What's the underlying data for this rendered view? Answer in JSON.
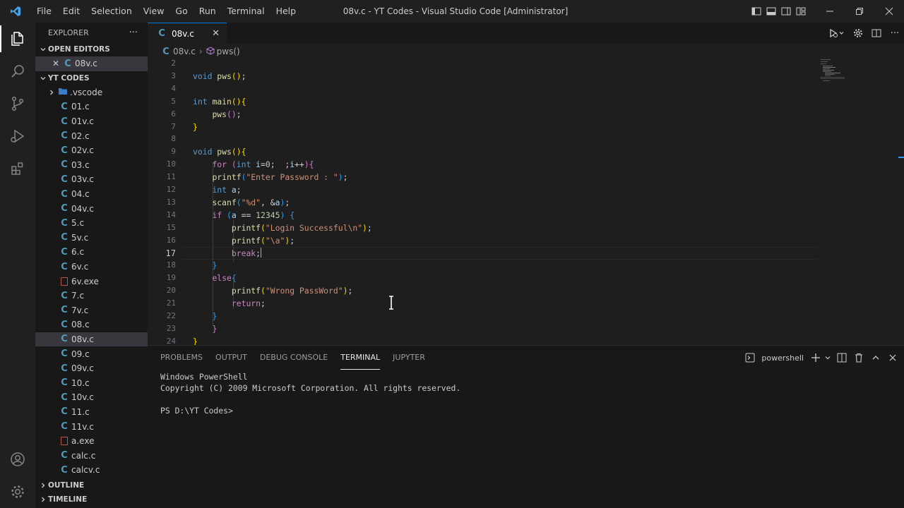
{
  "window": {
    "title": "08v.c - YT Codes - Visual Studio Code [Administrator]"
  },
  "menu": [
    "File",
    "Edit",
    "Selection",
    "View",
    "Go",
    "Run",
    "Terminal",
    "Help"
  ],
  "sidebar": {
    "title": "EXPLORER",
    "more": "···",
    "open_editors_label": "OPEN EDITORS",
    "open_editor_file": "08v.c",
    "folder_label": "YT CODES",
    "files": [
      {
        "name": ".vscode",
        "type": "folder"
      },
      {
        "name": "01.c",
        "type": "c"
      },
      {
        "name": "01v.c",
        "type": "c"
      },
      {
        "name": "02.c",
        "type": "c"
      },
      {
        "name": "02v.c",
        "type": "c"
      },
      {
        "name": "03.c",
        "type": "c"
      },
      {
        "name": "03v.c",
        "type": "c"
      },
      {
        "name": "04.c",
        "type": "c"
      },
      {
        "name": "04v.c",
        "type": "c"
      },
      {
        "name": "5.c",
        "type": "c"
      },
      {
        "name": "5v.c",
        "type": "c"
      },
      {
        "name": "6.c",
        "type": "c"
      },
      {
        "name": "6v.c",
        "type": "c"
      },
      {
        "name": "6v.exe",
        "type": "exe"
      },
      {
        "name": "7.c",
        "type": "c"
      },
      {
        "name": "7v.c",
        "type": "c"
      },
      {
        "name": "08.c",
        "type": "c"
      },
      {
        "name": "08v.c",
        "type": "c",
        "selected": true
      },
      {
        "name": "09.c",
        "type": "c"
      },
      {
        "name": "09v.c",
        "type": "c"
      },
      {
        "name": "10.c",
        "type": "c"
      },
      {
        "name": "10v.c",
        "type": "c"
      },
      {
        "name": "11.c",
        "type": "c"
      },
      {
        "name": "11v.c",
        "type": "c"
      },
      {
        "name": "a.exe",
        "type": "exe"
      },
      {
        "name": "calc.c",
        "type": "c"
      },
      {
        "name": "calcv.c",
        "type": "c"
      }
    ],
    "outline_label": "OUTLINE",
    "timeline_label": "TIMELINE"
  },
  "editor": {
    "tab_label": "08v.c",
    "breadcrumb_file": "08v.c",
    "breadcrumb_symbol": "pws()",
    "current_line": 17,
    "lines": [
      {
        "n": "2",
        "html": ""
      },
      {
        "n": "3",
        "html": "<span class=\"kw\">void</span> <span class=\"fn\">pws</span><span class=\"p1\">()</span>;"
      },
      {
        "n": "4",
        "html": ""
      },
      {
        "n": "5",
        "html": "<span class=\"kw\">int</span> <span class=\"fn\">main</span><span class=\"p1\">(){</span>"
      },
      {
        "n": "6",
        "html": "    <span class=\"fn\">pws</span><span class=\"p2\">()</span>;"
      },
      {
        "n": "7",
        "html": "<span class=\"p1\">}</span>"
      },
      {
        "n": "8",
        "html": ""
      },
      {
        "n": "9",
        "html": "<span class=\"kw\">void</span> <span class=\"fn\">pws</span><span class=\"p1\">(){</span>"
      },
      {
        "n": "10",
        "html": "    <span class=\"ctl\">for</span> <span class=\"p2\">(</span><span class=\"kw\">int</span> <span class=\"var\">i</span>=<span class=\"num\">0</span>;  ;<span class=\"var\">i</span>++<span class=\"p2\">){</span>"
      },
      {
        "n": "11",
        "html": "    <span class=\"fn\">printf</span><span class=\"p3\">(</span><span class=\"str\">\"Enter Password : \"</span><span class=\"p3\">)</span>;"
      },
      {
        "n": "12",
        "html": "    <span class=\"kw\">int</span> <span class=\"var\">a</span>;"
      },
      {
        "n": "13",
        "html": "    <span class=\"fn\">scanf</span><span class=\"p3\">(</span><span class=\"str\">\"%d\"</span>, &amp;<span class=\"var\">a</span><span class=\"p3\">)</span>;"
      },
      {
        "n": "14",
        "html": "    <span class=\"ctl\">if</span> <span class=\"p3\">(</span><span class=\"var\">a</span> == <span class=\"num\">12345</span><span class=\"p3\">)</span> <span class=\"p3\">{</span>"
      },
      {
        "n": "15",
        "html": "        <span class=\"fn\">printf</span><span class=\"p1\">(</span><span class=\"str\">\"Login Successful\\n\"</span><span class=\"p1\">)</span>;"
      },
      {
        "n": "16",
        "html": "        <span class=\"fn\">printf</span><span class=\"p1\">(</span><span class=\"str\">\"\\a\"</span><span class=\"p1\">)</span>;"
      },
      {
        "n": "17",
        "html": "        <span class=\"ctl\">break</span>;"
      },
      {
        "n": "18",
        "html": "    <span class=\"p3\">}</span>"
      },
      {
        "n": "19",
        "html": "    <span class=\"ctl\">else</span><span class=\"p3\">{</span>"
      },
      {
        "n": "20",
        "html": "        <span class=\"fn\">printf</span><span class=\"p1\">(</span><span class=\"str\">\"Wrong PassWord\"</span><span class=\"p1\">)</span>;"
      },
      {
        "n": "21",
        "html": "        <span class=\"ctl\">return</span>;"
      },
      {
        "n": "22",
        "html": "    <span class=\"p3\">}</span>"
      },
      {
        "n": "23",
        "html": "    <span class=\"p2\">}</span>"
      },
      {
        "n": "24",
        "html": "<span class=\"p1\">}</span>"
      }
    ]
  },
  "panel": {
    "tabs": [
      "PROBLEMS",
      "OUTPUT",
      "DEBUG CONSOLE",
      "TERMINAL",
      "JUPYTER"
    ],
    "active_tab": "TERMINAL",
    "shell_label": "powershell",
    "terminal_lines": [
      "Windows PowerShell",
      "Copyright (C) 2009 Microsoft Corporation. All rights reserved.",
      "",
      "PS D:\\YT Codes>"
    ]
  },
  "colors": {
    "accent": "#0078d4",
    "c_icon": "#519aba",
    "exe_icon": "#c2504b"
  }
}
